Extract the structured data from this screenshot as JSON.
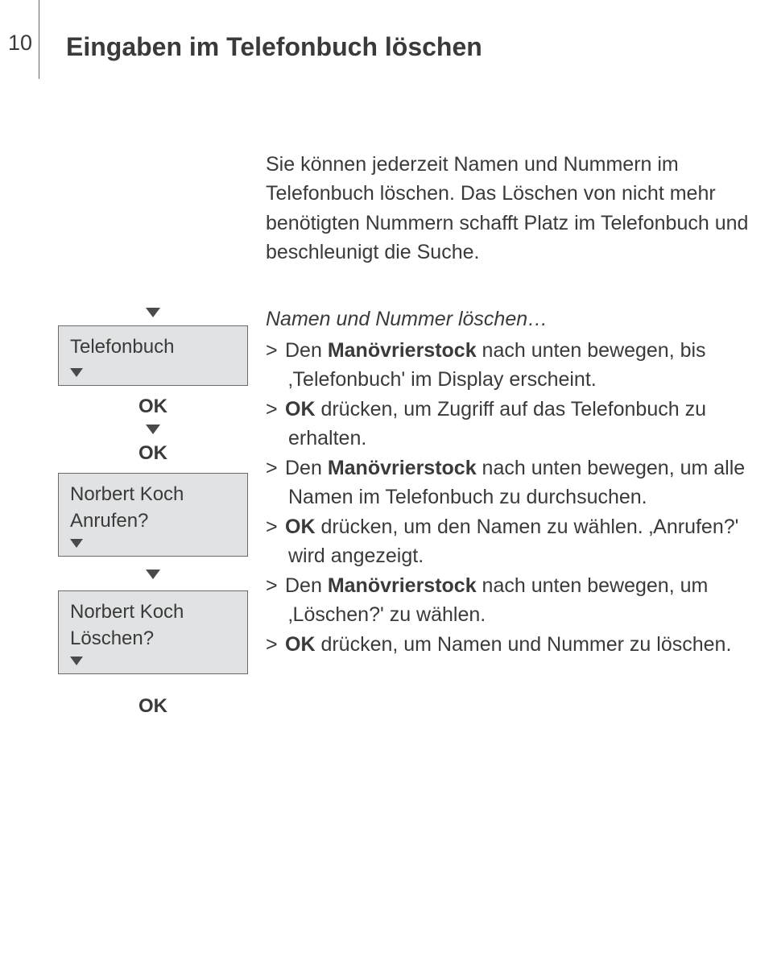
{
  "page_number": "10",
  "heading": "Eingaben im Telefonbuch löschen",
  "intro": "Sie können jederzeit Namen und Nummern im Telefonbuch löschen. Das Löschen von nicht mehr benötigten Nummern schafft Platz im Telefonbuch und beschleunigt die Suche.",
  "left": {
    "box1_line1": "Telefonbuch",
    "ok1": "OK",
    "ok2": "OK",
    "box2_line1": "Norbert Koch",
    "box2_line2": "Anrufen?",
    "box3_line1": "Norbert Koch",
    "box3_line2": "Löschen?",
    "ok3": "OK"
  },
  "right": {
    "subheading": "Namen und Nummer löschen…",
    "gt": ">",
    "s1a": "Den ",
    "s1b": "Manövrierstock",
    "s1c": " nach unten bewegen, bis ‚Telefonbuch' im Display erscheint.",
    "s2a": "OK",
    "s2b": " drücken, um Zugriff auf das Telefonbuch zu erhalten.",
    "s3a": "Den ",
    "s3b": "Manövrierstock",
    "s3c": " nach unten bewegen, um alle Namen im Telefonbuch zu durchsuchen.",
    "s4a": "OK",
    "s4b": " drücken, um den Namen zu wählen. ‚Anrufen?' wird angezeigt.",
    "s5a": "Den ",
    "s5b": "Manövrierstock",
    "s5c": " nach unten bewegen, um ‚Löschen?' zu wählen.",
    "s6a": "OK",
    "s6b": " drücken, um Namen und Nummer zu löschen."
  }
}
